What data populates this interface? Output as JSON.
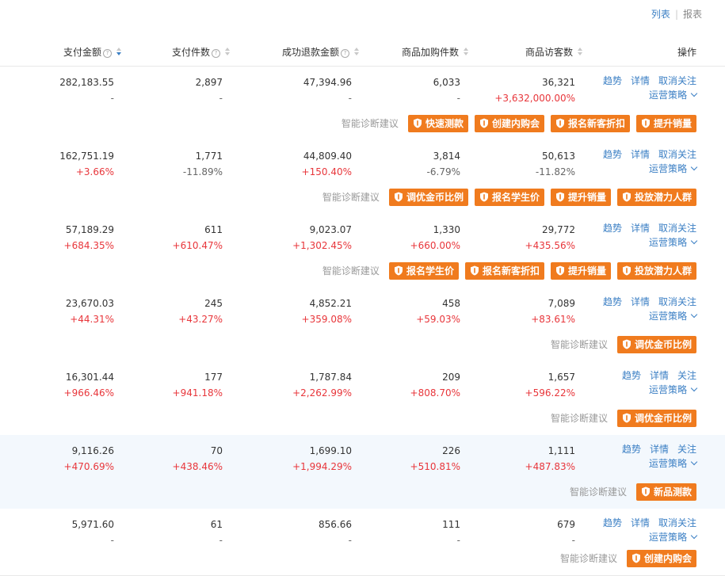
{
  "view_switch": {
    "list": "列表",
    "separator": "|",
    "report": "报表"
  },
  "header": {
    "pay_amount": "支付金额",
    "pay_count": "支付件数",
    "refund_amount": "成功退款金额",
    "cart_count": "商品加购件数",
    "visitors": "商品访客数",
    "operation": "操作",
    "help_glyph": "?"
  },
  "diag_label": "智能诊断建议",
  "strategy_label": "运营策略",
  "rows": [
    {
      "pay_amount": "282,183.55",
      "pay_amount_change": "-",
      "pay_count": "2,897",
      "pay_count_change": "-",
      "refund_amount": "47,394.96",
      "refund_amount_change": "-",
      "cart_count": "6,033",
      "cart_count_change": "-",
      "visitors": "36,321",
      "visitors_change": "+3,632,000.00%",
      "ops": [
        "趋势",
        "详情",
        "取消关注"
      ],
      "tags": [
        "快速测款",
        "创建内购会",
        "报名新客折扣",
        "提升销量"
      ]
    },
    {
      "pay_amount": "162,751.19",
      "pay_amount_change": "+3.66%",
      "pay_count": "1,771",
      "pay_count_change": "-11.89%",
      "refund_amount": "44,809.40",
      "refund_amount_change": "+150.40%",
      "cart_count": "3,814",
      "cart_count_change": "-6.79%",
      "visitors": "50,613",
      "visitors_change": "-11.82%",
      "ops": [
        "趋势",
        "详情",
        "取消关注"
      ],
      "tags": [
        "调优金币比例",
        "报名学生价",
        "提升销量",
        "投放潜力人群"
      ]
    },
    {
      "pay_amount": "57,189.29",
      "pay_amount_change": "+684.35%",
      "pay_count": "611",
      "pay_count_change": "+610.47%",
      "refund_amount": "9,023.07",
      "refund_amount_change": "+1,302.45%",
      "cart_count": "1,330",
      "cart_count_change": "+660.00%",
      "visitors": "29,772",
      "visitors_change": "+435.56%",
      "ops": [
        "趋势",
        "详情",
        "取消关注"
      ],
      "tags": [
        "报名学生价",
        "报名新客折扣",
        "提升销量",
        "投放潜力人群"
      ]
    },
    {
      "pay_amount": "23,670.03",
      "pay_amount_change": "+44.31%",
      "pay_count": "245",
      "pay_count_change": "+43.27%",
      "refund_amount": "4,852.21",
      "refund_amount_change": "+359.08%",
      "cart_count": "458",
      "cart_count_change": "+59.03%",
      "visitors": "7,089",
      "visitors_change": "+83.61%",
      "ops": [
        "趋势",
        "详情",
        "取消关注"
      ],
      "tags": [
        "调优金币比例"
      ]
    },
    {
      "pay_amount": "16,301.44",
      "pay_amount_change": "+966.46%",
      "pay_count": "177",
      "pay_count_change": "+941.18%",
      "refund_amount": "1,787.84",
      "refund_amount_change": "+2,262.99%",
      "cart_count": "209",
      "cart_count_change": "+808.70%",
      "visitors": "1,657",
      "visitors_change": "+596.22%",
      "ops": [
        "趋势",
        "详情",
        "关注"
      ],
      "tags": [
        "调优金币比例"
      ]
    },
    {
      "pay_amount": "9,116.26",
      "pay_amount_change": "+470.69%",
      "pay_count": "70",
      "pay_count_change": "+438.46%",
      "refund_amount": "1,699.10",
      "refund_amount_change": "+1,994.29%",
      "cart_count": "226",
      "cart_count_change": "+510.81%",
      "visitors": "1,111",
      "visitors_change": "+487.83%",
      "ops": [
        "趋势",
        "详情",
        "关注"
      ],
      "tags": [
        "新品测款"
      ]
    },
    {
      "pay_amount": "5,971.60",
      "pay_amount_change": "-",
      "pay_count": "61",
      "pay_count_change": "-",
      "refund_amount": "856.66",
      "refund_amount_change": "-",
      "cart_count": "111",
      "cart_count_change": "-",
      "visitors": "679",
      "visitors_change": "-",
      "ops": [
        "趋势",
        "详情",
        "取消关注"
      ],
      "tags": [
        "创建内购会"
      ]
    }
  ],
  "colors": {
    "link": "#3b7fc4",
    "tag_bg": "#f07b1e",
    "positive": "#e8363b",
    "highlight_row": "#f3f8fd"
  },
  "icons": {
    "help": "question-circle-icon",
    "sort": "sort-caret-icon",
    "tag": "shield-icon",
    "strategy": "chevron-down-icon"
  }
}
